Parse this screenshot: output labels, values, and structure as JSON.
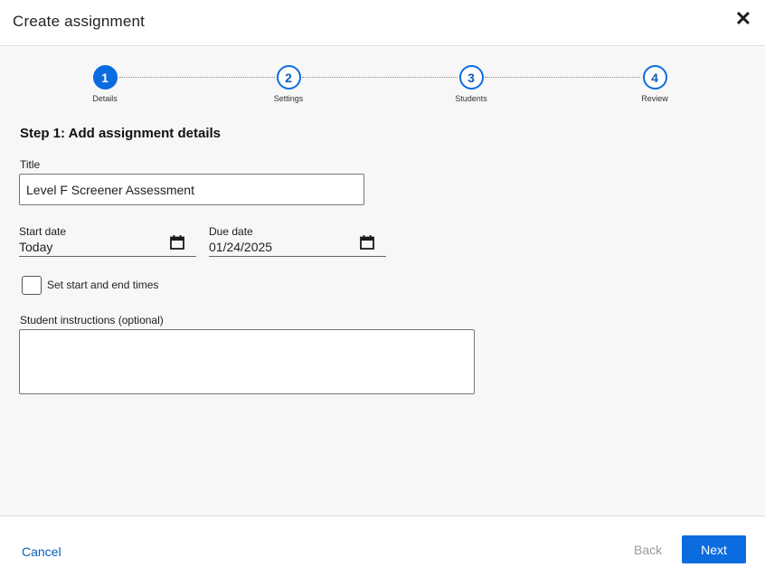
{
  "dialog": {
    "title": "Create assignment",
    "close_icon": "close-icon",
    "close_glyph": "✕"
  },
  "stepper": {
    "current_step": 1,
    "steps": [
      {
        "number": "1",
        "label": "Details",
        "state": "active"
      },
      {
        "number": "2",
        "label": "Settings",
        "state": "pending"
      },
      {
        "number": "3",
        "label": "Students",
        "state": "pending"
      },
      {
        "number": "4",
        "label": "Review",
        "state": "pending"
      }
    ]
  },
  "form": {
    "heading": "Step 1: Add assignment details",
    "title_label": "Title",
    "title_value": "Level F Screener Assessment",
    "start_date_label": "Start date",
    "start_date_value": "Today",
    "due_date_label": "Due date",
    "due_date_value": "01/24/2025",
    "calendar_icon": "calendar-icon",
    "times_checkbox_label": "Set start and end times",
    "times_checkbox_checked": false,
    "instructions_label": "Student instructions (optional)",
    "instructions_value": ""
  },
  "footer": {
    "cancel_label": "Cancel",
    "back_label": "Back",
    "next_label": "Next"
  },
  "colors": {
    "accent": "#0b6ce0",
    "link": "#0b5bb8",
    "disabled": "#9a9a9a",
    "body_bg": "#f7f7f7"
  }
}
